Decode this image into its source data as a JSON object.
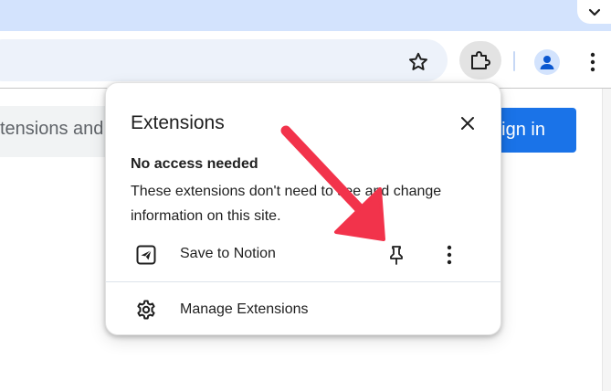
{
  "browser": {
    "tab_search_icon": "chevron-down-icon",
    "toolbar": {
      "bookmark_icon": "star-icon",
      "extensions_icon": "puzzle-icon",
      "profile_icon": "person-icon",
      "menu_icon": "kebab-icon"
    }
  },
  "page": {
    "search_text": "tensions and",
    "signin_label": "Sign in",
    "accent_color": "#1a73e8"
  },
  "popup": {
    "title": "Extensions",
    "close_icon": "close-icon",
    "section_heading": "No access needed",
    "section_description": "These extensions don't need to see and change information on this site.",
    "extensions": [
      {
        "name": "Save to Notion",
        "icon": "notion-send-icon",
        "pin_icon": "pin-icon",
        "more_icon": "kebab-icon"
      }
    ],
    "manage_label": "Manage Extensions",
    "manage_icon": "gear-icon"
  },
  "annotation": {
    "arrow_color": "#f2334b"
  }
}
